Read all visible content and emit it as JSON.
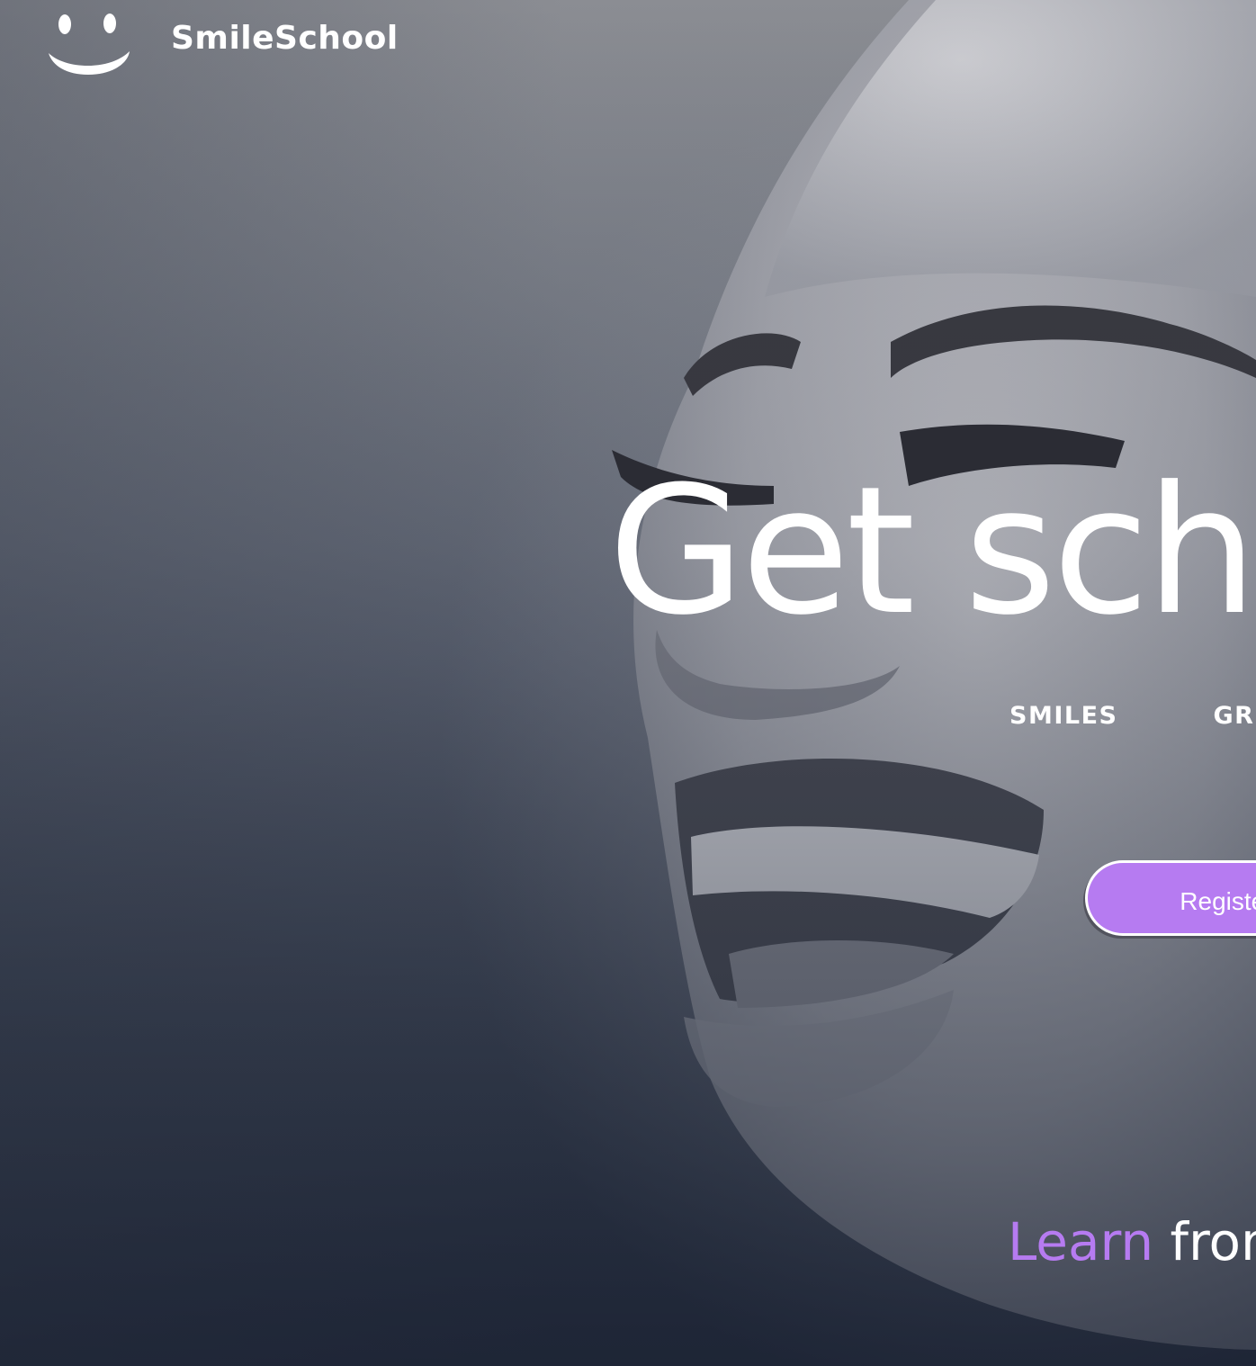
{
  "brand": {
    "name": "SmileSchool",
    "logo_icon": "smiley-face-icon"
  },
  "hero": {
    "headline": "Get sch",
    "subnav": [
      "SMILES",
      "GRI"
    ],
    "cta_label": "Register fo",
    "tagline_accent": "Learn",
    "tagline_rest": "from"
  },
  "colors": {
    "accent": "#b67bf1",
    "text": "#ffffff",
    "background_dark": "#1f2736"
  }
}
